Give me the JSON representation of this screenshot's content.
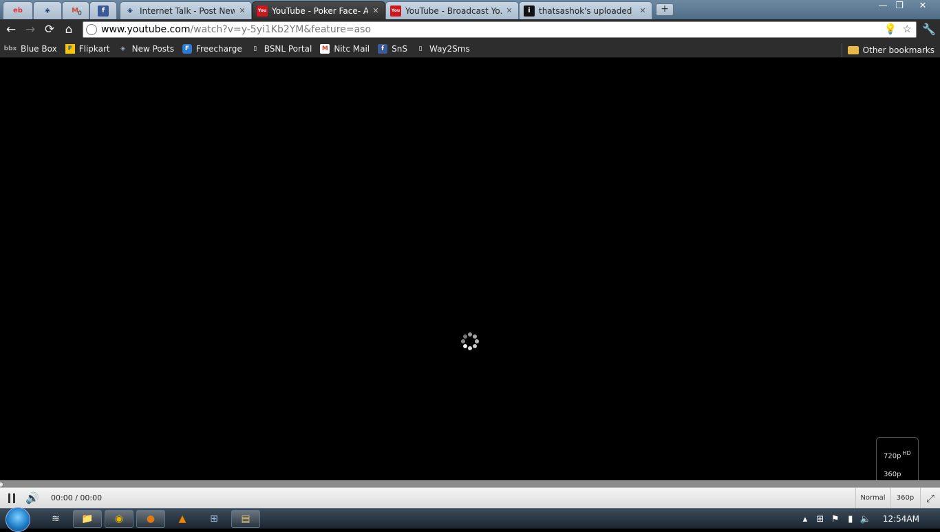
{
  "tabs": [
    {
      "title": "",
      "favicon": "ebay-icon",
      "glyph": "eb",
      "pinned": true
    },
    {
      "title": "",
      "favicon": "globe-icon",
      "glyph": "◈",
      "pinned": true
    },
    {
      "title": "",
      "favicon": "gmail-icon",
      "glyph": "M",
      "badge": "0",
      "pinned": true
    },
    {
      "title": "",
      "favicon": "facebook-icon",
      "glyph": "f",
      "pinned": true
    },
    {
      "title": "Internet Talk - Post New ...",
      "favicon": "globe-icon",
      "glyph": "◈"
    },
    {
      "title": "YouTube - Poker Face- A...",
      "favicon": "youtube-icon",
      "glyph": "You",
      "active": true
    },
    {
      "title": "YouTube - Broadcast Yo...",
      "favicon": "youtube-icon",
      "glyph": "You"
    },
    {
      "title": "thatsashok's uploaded i...",
      "favicon": "info-icon",
      "glyph": "i"
    }
  ],
  "window_controls": {
    "minimize": "—",
    "restore": "❐",
    "close": "✕"
  },
  "new_tab_label": "+",
  "toolbar": {
    "back": "←",
    "forward": "→",
    "reload": "⟳",
    "home": "⌂",
    "url_host": "www.youtube.com",
    "url_path": "/watch?v=y-5yi1Kb2YM&feature=aso",
    "bulb": "💡",
    "star": "☆",
    "wrench": "🔧"
  },
  "bookmarks": [
    {
      "label": "Blue Box",
      "icon": "bluebox-icon",
      "glyph": "bbx"
    },
    {
      "label": "Flipkart",
      "icon": "flipkart-icon",
      "glyph": "F"
    },
    {
      "label": "New Posts",
      "icon": "globe-icon",
      "glyph": "◈"
    },
    {
      "label": "Freecharge",
      "icon": "freecharge-icon",
      "glyph": "F"
    },
    {
      "label": "BSNL Portal",
      "icon": "page-icon",
      "glyph": "▯"
    },
    {
      "label": "Nitc Mail",
      "icon": "gmail-icon",
      "glyph": "M"
    },
    {
      "label": "SnS",
      "icon": "facebook-icon",
      "glyph": "f"
    },
    {
      "label": "Way2Sms",
      "icon": "page-icon",
      "glyph": "▯"
    }
  ],
  "other_bookmarks": "Other bookmarks",
  "player": {
    "time": "00:00 / 00:00",
    "size_mode": "Normal",
    "quality": "360p",
    "quality_options": [
      "720p",
      "360p"
    ],
    "hd_badge": "HD",
    "progress": 0
  },
  "taskbar": {
    "clock": "12:54AM",
    "apps": [
      {
        "name": "wifi-app",
        "glyph": "≋"
      },
      {
        "name": "explorer-app",
        "glyph": "📁"
      },
      {
        "name": "chrome-app",
        "glyph": "◉"
      },
      {
        "name": "firefox-app",
        "glyph": "●"
      },
      {
        "name": "vlc-app",
        "glyph": "▲"
      },
      {
        "name": "network-app",
        "glyph": "⊞"
      },
      {
        "name": "folders-app",
        "glyph": "▤"
      }
    ]
  },
  "colors": {
    "youtube_red": "#cc181e",
    "facebook_blue": "#3b5998",
    "gmail_red": "#d14836"
  }
}
